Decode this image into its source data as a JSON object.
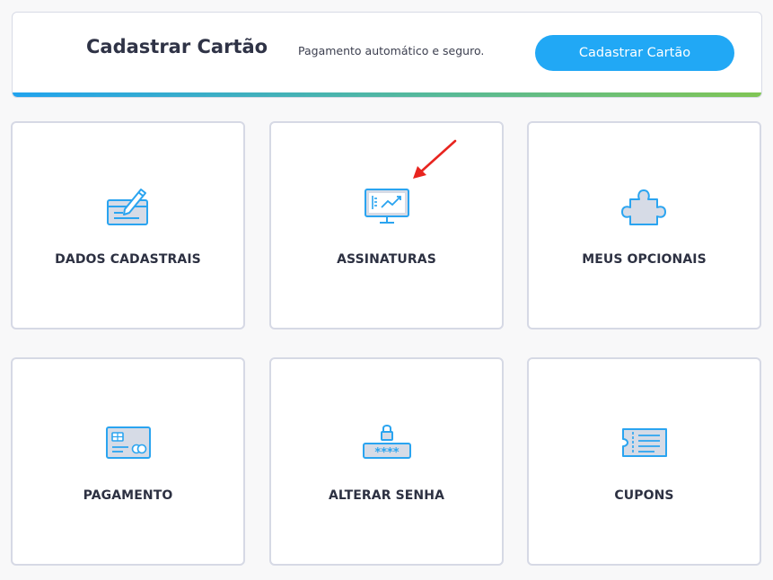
{
  "banner": {
    "title": "Cadastrar Cartão",
    "subtitle": "Pagamento automático e seguro.",
    "button_label": "Cadastrar Cartão"
  },
  "cards": [
    {
      "label": "DADOS CADASTRAIS",
      "icon": "form-pencil-icon"
    },
    {
      "label": "ASSINATURAS",
      "icon": "monitor-chart-icon"
    },
    {
      "label": "MEUS OPCIONAIS",
      "icon": "puzzle-piece-icon"
    },
    {
      "label": "PAGAMENTO",
      "icon": "credit-card-icon"
    },
    {
      "label": "ALTERAR SENHA",
      "icon": "password-lock-icon"
    },
    {
      "label": "CUPONS",
      "icon": "coupon-ticket-icon"
    }
  ],
  "colors": {
    "accent": "#21a8f5",
    "icon_stroke": "#2aa4f0",
    "icon_fill": "#d6dbe6",
    "annotation": "#e8241f"
  }
}
